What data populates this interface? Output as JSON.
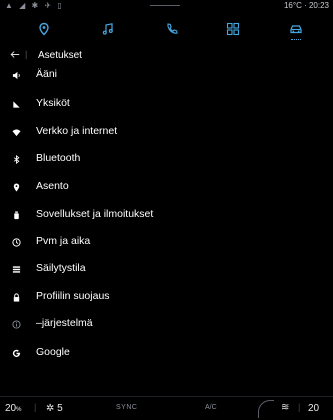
{
  "colors": {
    "accent": "#46a8e0",
    "background": "#000000",
    "text": "#ffffff",
    "muted": "#8a8f98"
  },
  "status": {
    "left_glyphs": "▲ ◢ ✱ ✈ ▯",
    "right_text": "16°C · 20:23"
  },
  "nav": [
    {
      "icon": "location-pin-icon",
      "active": false
    },
    {
      "icon": "music-note-icon",
      "active": false
    },
    {
      "icon": "phone-icon",
      "active": false
    },
    {
      "icon": "apps-grid-icon",
      "active": false
    },
    {
      "icon": "car-icon",
      "active": true
    }
  ],
  "header": {
    "title": "Asetukset"
  },
  "settings": [
    {
      "label": "Ääni",
      "icon": "speaker-icon"
    },
    {
      "label": "Yksiköt",
      "icon": "units-icon"
    },
    {
      "label": "Verkko ja internet",
      "icon": "wifi-icon"
    },
    {
      "label": "Bluetooth",
      "icon": "bluetooth-icon"
    },
    {
      "label": "Asento",
      "icon": "location-icon"
    },
    {
      "label": "Sovellukset ja ilmoitukset",
      "icon": "apps-icon"
    },
    {
      "label": "Pvm ja aika",
      "icon": "clock-icon"
    },
    {
      "label": "Säilytystila",
      "icon": "storage-icon"
    },
    {
      "label": "Profiilin suojaus",
      "icon": "lock-icon"
    },
    {
      "label": "–järjestelmä",
      "icon": "info-icon"
    },
    {
      "label": "Google",
      "icon": "google-icon"
    }
  ],
  "climate": {
    "temp_left": "20",
    "fan": "5",
    "sync": "SYNC",
    "ac": "A/C",
    "temp_right": "20"
  }
}
